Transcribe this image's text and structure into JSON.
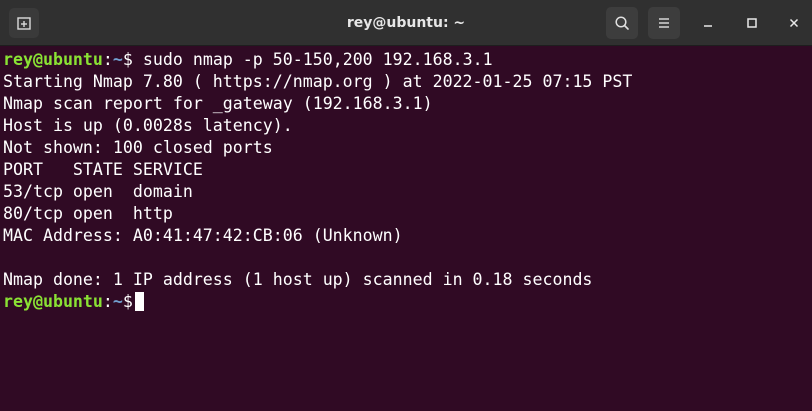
{
  "window": {
    "title": "rey@ubuntu: ~"
  },
  "titlebar": {
    "icons": [
      "new-tab-icon",
      "search-icon",
      "hamburger-menu-icon",
      "minimize-icon",
      "maximize-icon",
      "close-icon"
    ]
  },
  "prompt": {
    "user_host": "rey@ubuntu",
    "colon": ":",
    "path": "~",
    "symbol": "$"
  },
  "command": " sudo nmap -p 50-150,200 192.168.3.1",
  "output": [
    "Starting Nmap 7.80 ( https://nmap.org ) at 2022-01-25 07:15 PST",
    "Nmap scan report for _gateway (192.168.3.1)",
    "Host is up (0.0028s latency).",
    "Not shown: 100 closed ports",
    "PORT   STATE SERVICE",
    "53/tcp open  domain",
    "80/tcp open  http",
    "MAC Address: A0:41:47:42:CB:06 (Unknown)",
    "",
    "Nmap done: 1 IP address (1 host up) scanned in 0.18 seconds"
  ],
  "colors": {
    "background": "#300a24",
    "titlebar": "#303030",
    "prompt_user": "#8ae234",
    "prompt_path": "#729fcf",
    "text": "#ffffff"
  }
}
